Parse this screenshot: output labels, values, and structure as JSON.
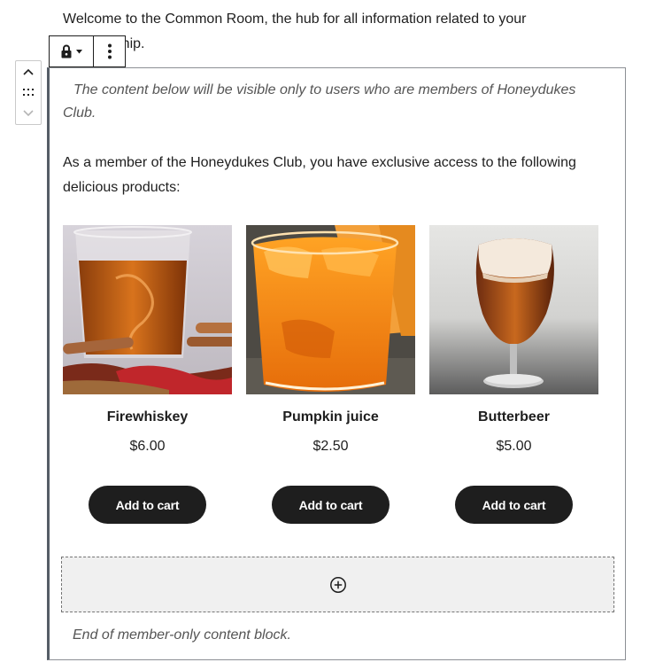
{
  "intro": {
    "text": "Welcome to the Common Room, the hub for all information related to your membership."
  },
  "toolbar": {
    "lock_icon": "lock-icon",
    "more_icon": "more-vertical-icon"
  },
  "movers": {
    "up_icon": "chevron-up-icon",
    "drag_icon": "drag-handle-icon",
    "down_icon": "chevron-down-icon"
  },
  "block": {
    "notice_top": "The content below will be visible only to users who are members of Honeydukes Club.",
    "access_text": "As a member of the Honeydukes Club, you have exclusive access to the following delicious products:",
    "notice_bottom": "End of member-only content block.",
    "appender_icon": "plus-circle-icon"
  },
  "products": [
    {
      "name": "Firewhiskey",
      "price": "$6.00",
      "button": "Add to cart"
    },
    {
      "name": "Pumpkin juice",
      "price": "$2.50",
      "button": "Add to cart"
    },
    {
      "name": "Butterbeer",
      "price": "$5.00",
      "button": "Add to cart"
    }
  ]
}
